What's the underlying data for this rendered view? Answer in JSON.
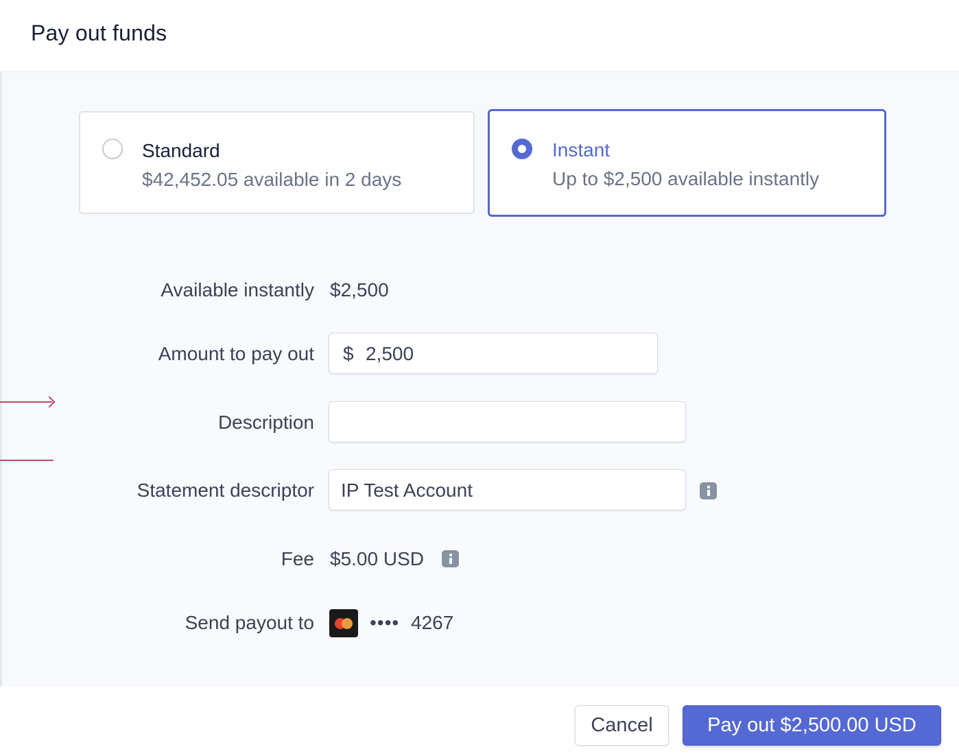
{
  "dialog": {
    "title": "Pay out funds"
  },
  "options": {
    "standard": {
      "title": "Standard",
      "subtitle": "$42,452.05 available in 2 days",
      "selected": false
    },
    "instant": {
      "title": "Instant",
      "subtitle": "Up to $2,500 available instantly",
      "selected": true
    }
  },
  "form": {
    "available": {
      "label": "Available instantly",
      "value": "$2,500"
    },
    "amount": {
      "label": "Amount to pay out",
      "currency": "$",
      "value": "2,500"
    },
    "description": {
      "label": "Description",
      "value": ""
    },
    "statement": {
      "label": "Statement descriptor",
      "value": "IP Test Account"
    },
    "fee": {
      "label": "Fee",
      "value": "$5.00 USD"
    },
    "destination": {
      "label": "Send payout to",
      "card_dots": "••••",
      "card_last4": "4267"
    }
  },
  "footer": {
    "cancel_label": "Cancel",
    "submit_label": "Pay out $2,500.00 USD"
  },
  "colors": {
    "accent": "#5469d4",
    "annotation": "#c4486a"
  },
  "icons": [
    "info-icon",
    "mastercard-icon",
    "radio-selected-icon",
    "radio-unselected-icon"
  ]
}
